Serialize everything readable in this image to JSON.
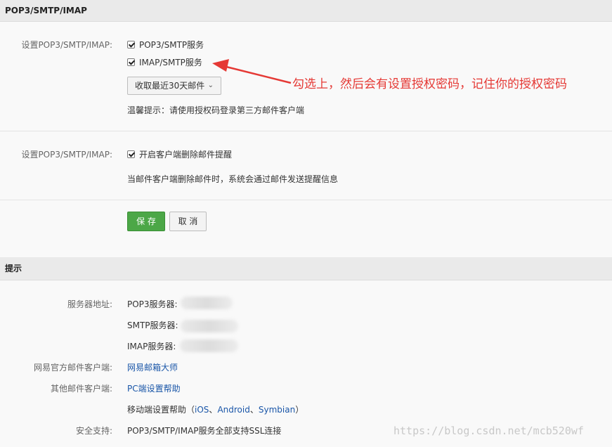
{
  "section1": {
    "title": "POP3/SMTP/IMAP"
  },
  "settings": {
    "label1": "设置POP3/SMTP/IMAP:",
    "pop3_option": "POP3/SMTP服务",
    "imap_option": "IMAP/SMTP服务",
    "fetch_select": "收取最近30天邮件",
    "hint": "温馨提示：请使用授权码登录第三方邮件客户端",
    "label2": "设置POP3/SMTP/IMAP:",
    "delete_option": "开启客户端删除邮件提醒",
    "delete_desc": "当邮件客户端删除邮件时，系统会通过邮件发送提醒信息",
    "save": "保 存",
    "cancel": "取 消"
  },
  "annotation": {
    "text": "勾选上，然后会有设置授权密码，记住你的授权密码",
    "color": "#e53935"
  },
  "section2": {
    "title": "提示"
  },
  "tips": {
    "server_label": "服务器地址:",
    "pop3_server": "POP3服务器:",
    "smtp_server": "SMTP服务器:",
    "imap_server": "IMAP服务器:",
    "official_label": "网易官方邮件客户端:",
    "official_link": "网易邮箱大师",
    "other_label": "其他邮件客户端:",
    "pc_link": "PC端设置帮助",
    "mobile_prefix": "移动端设置帮助（",
    "ios": "iOS",
    "sep1": "、",
    "android": "Android",
    "sep2": "、",
    "symbian": "Symbian",
    "mobile_suffix": "）",
    "security_label": "安全支持:",
    "security_text": "POP3/SMTP/IMAP服务全部支持SSL连接"
  },
  "watermark": "https://blog.csdn.net/mcb520wf",
  "colors": {
    "save_green": "#4ca747",
    "link_blue": "#1a56a8",
    "annotation_red": "#e53935"
  }
}
